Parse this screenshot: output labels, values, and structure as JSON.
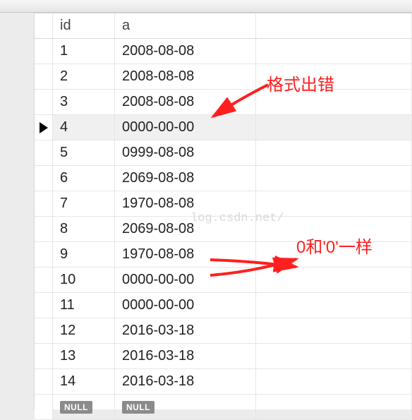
{
  "toolbar": {},
  "columns": {
    "id": "id",
    "a": "a"
  },
  "selected_row_index": 3,
  "rows": [
    {
      "id": "1",
      "a": "2008-08-08"
    },
    {
      "id": "2",
      "a": "2008-08-08"
    },
    {
      "id": "3",
      "a": "2008-08-08"
    },
    {
      "id": "4",
      "a": "0000-00-00"
    },
    {
      "id": "5",
      "a": "0999-08-08"
    },
    {
      "id": "6",
      "a": "2069-08-08"
    },
    {
      "id": "7",
      "a": "1970-08-08"
    },
    {
      "id": "8",
      "a": "2069-08-08"
    },
    {
      "id": "9",
      "a": "1970-08-08"
    },
    {
      "id": "10",
      "a": "0000-00-00"
    },
    {
      "id": "11",
      "a": "0000-00-00"
    },
    {
      "id": "12",
      "a": "2016-03-18"
    },
    {
      "id": "13",
      "a": "2016-03-18"
    },
    {
      "id": "14",
      "a": "2016-03-18"
    }
  ],
  "null_label": "NULL",
  "annotations": {
    "a1": "格式出错",
    "a2": "0和'0'一样"
  },
  "watermark": "log.csdn.net/"
}
